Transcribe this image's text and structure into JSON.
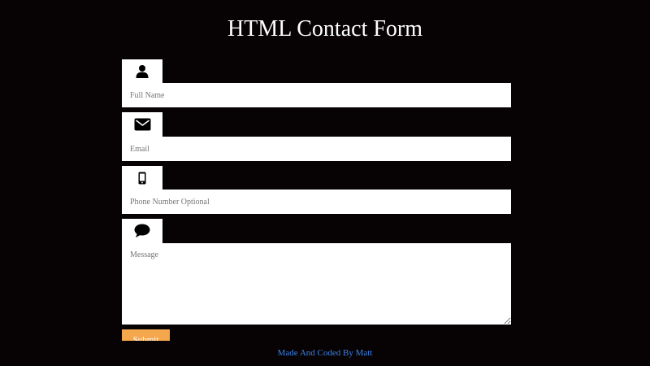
{
  "page": {
    "title": "HTML Contact Form",
    "footer": "Made And Coded By Matt"
  },
  "form": {
    "fields": [
      {
        "icon": "user-icon",
        "placeholder": "Full Name"
      },
      {
        "icon": "envelope-icon",
        "placeholder": "Email"
      },
      {
        "icon": "mobile-phone-icon",
        "placeholder": "Phone Number Optional"
      },
      {
        "icon": "speech-bubble-icon",
        "placeholder": "Message"
      }
    ],
    "submit_label": "Submit"
  },
  "colors": {
    "background": "#070305",
    "field_background": "#ffffff",
    "submit_background": "#f5a74d",
    "footer_text": "#3b82e6"
  }
}
